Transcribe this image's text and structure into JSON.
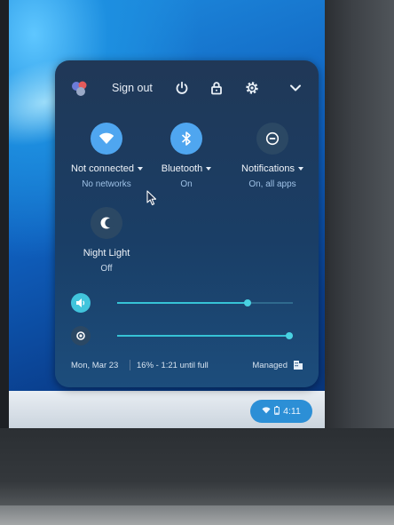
{
  "topbar": {
    "sign_out_label": "Sign out",
    "icons": [
      "avatar-icon",
      "power-icon",
      "lock-icon",
      "gear-icon",
      "chevron-down-icon"
    ]
  },
  "features": {
    "network": {
      "label": "Not connected",
      "status": "No networks",
      "icon": "wifi-icon",
      "active": true
    },
    "bluetooth": {
      "label": "Bluetooth",
      "status": "On",
      "icon": "bluetooth-icon",
      "active": true
    },
    "notifications": {
      "label": "Notifications",
      "status": "On, all apps",
      "icon": "do-not-disturb-icon",
      "active": false
    },
    "night_light": {
      "label": "Night Light",
      "status": "Off",
      "icon": "night-light-icon",
      "active": false
    }
  },
  "sliders": {
    "volume": {
      "icon": "volume-icon",
      "level": 0.74
    },
    "brightness": {
      "icon": "brightness-icon",
      "level": 0.98
    }
  },
  "footer": {
    "date": "Mon, Mar 23",
    "battery": "16% - 1:21 until full",
    "managed": "Managed"
  },
  "shelf": {
    "time": "4:11",
    "icons": [
      "wifi-icon",
      "battery-icon"
    ]
  },
  "colors": {
    "accent_on": "#4fa6f0",
    "slider": "#36c3d6",
    "panel": "#1a3e66"
  }
}
